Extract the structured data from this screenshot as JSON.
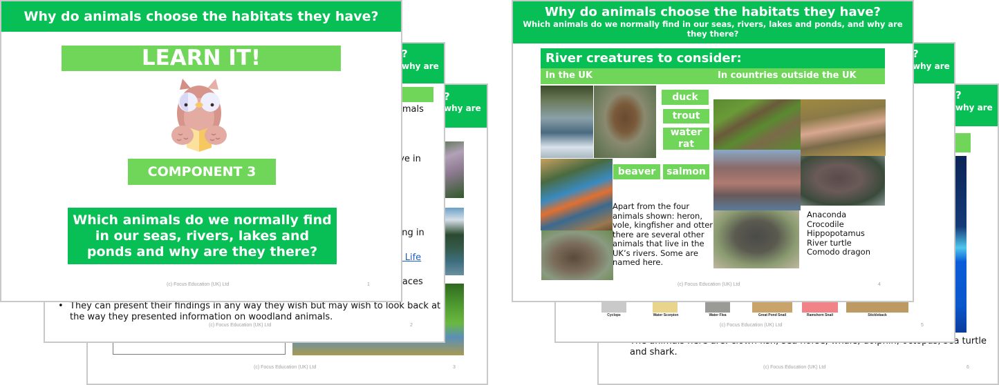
{
  "colors": {
    "dark_green": "#08bf56",
    "light_green": "#6fd65a",
    "link_blue": "#1a5fc4"
  },
  "left_stack": {
    "slide3": {
      "header_fragment": "?",
      "header_line2_fragment": "why are",
      "footer": "(c) Focus Education (UK) Ltd",
      "page": "3"
    },
    "slide2": {
      "header_fragment": "?",
      "header_line2_fragment": "why are",
      "text_fragments": [
        "nimals",
        "live in",
        "ving in",
        "al Life",
        "places"
      ],
      "bullet": "•",
      "bullet_text_line1": "They can present their findings in any way they wish but may wish to look back at",
      "bullet_text_line2": "the way they presented information on woodland animals.",
      "footer": "(c) Focus Education (UK) Ltd",
      "page": "2"
    },
    "slide1": {
      "header": "Why do animals choose the habitats they have?",
      "learn_it": "LEARN IT!",
      "icon": "owl-reading-book-icon",
      "component": "COMPONENT 3",
      "question": "Which animals do we normally find in our seas, rivers, lakes and ponds and why are they there?",
      "footer": "(c) Focus Education (UK) Ltd",
      "page": "1"
    }
  },
  "right_stack": {
    "slide6": {
      "header_fragment": "?",
      "header_line2_fragment": "why are",
      "text_line1": "The animals here are: clown fish, sea horse, whale, dolphin, octopus, sea turtle",
      "text_line2": "and shark.",
      "footer": "(c) Focus Education (UK) Ltd",
      "page": "6"
    },
    "slide5": {
      "header_fragment": "?",
      "header_line2_fragment": "why are",
      "captions": [
        "Cyclops",
        "Water Scorpion",
        "Water Flea",
        "Great Pond Snail",
        "Ramshorn Snail",
        "Stickleback"
      ],
      "footer": "(c) Focus Education (UK) Ltd",
      "page": "5"
    },
    "slide4": {
      "header": "Why do animals choose the habitats they have?",
      "subheader": "Which animals do we normally find in our seas, rivers, lakes and ponds, and why are they there?",
      "section_title": "River creatures to consider:",
      "col_uk": "In the UK",
      "col_abroad": "In countries outside the UK",
      "uk_tags": [
        "duck",
        "trout",
        "water rat",
        "beaver",
        "salmon"
      ],
      "uk_text": "Apart from the four animals shown: heron, vole, kingfisher and otter there are several other animals that live in the UK’s rivers. Some are named here.",
      "uk_photos": [
        "heron",
        "vole",
        "kingfisher",
        "otter"
      ],
      "abroad_photos": [
        "anaconda",
        "crocodile",
        "hippopotamus",
        "river turtle",
        "komodo dragon"
      ],
      "abroad_list": [
        "Anaconda",
        "Crocodile",
        "Hippopotamus",
        "River turtle",
        "Comodo dragon"
      ],
      "footer": "(c) Focus Education (UK) Ltd",
      "page": "4"
    }
  }
}
